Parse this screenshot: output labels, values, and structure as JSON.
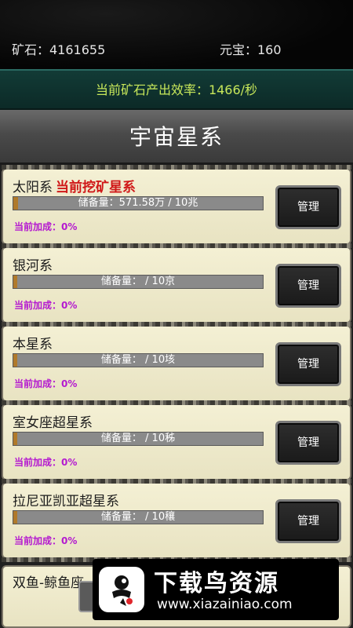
{
  "header": {
    "ore": "矿石：4161655",
    "yuanbao": "元宝：160"
  },
  "efficiency": "当前矿石产出效率：1466/秒",
  "title": "宇宙星系",
  "galaxies": [
    {
      "name": "太阳系",
      "current_tag": "当前挖矿星系",
      "storage": "储备量：571.58万 / 10兆",
      "fill": 0.02,
      "bonus": "当前加成：0%",
      "button": "管理"
    },
    {
      "name": "银河系",
      "current_tag": "",
      "storage": "储备量：  / 10京",
      "fill": 0.01,
      "bonus": "当前加成：0%",
      "button": "管理"
    },
    {
      "name": "本星系",
      "current_tag": "",
      "storage": "储备量：  / 10垓",
      "fill": 0.01,
      "bonus": "当前加成：0%",
      "button": "管理"
    },
    {
      "name": "室女座超星系",
      "current_tag": "",
      "storage": "储备量：  / 10秭",
      "fill": 0.01,
      "bonus": "当前加成：0%",
      "button": "管理"
    },
    {
      "name": "拉尼亚凯亚超星系",
      "current_tag": "",
      "storage": "储备量：  / 10穰",
      "fill": 0.01,
      "bonus": "当前加成：0%",
      "button": "管理"
    }
  ],
  "partial_name": "双鱼-鲸鱼座",
  "watermark": {
    "title": "下载鸟资源",
    "url": "www.xiazainiao.com"
  }
}
